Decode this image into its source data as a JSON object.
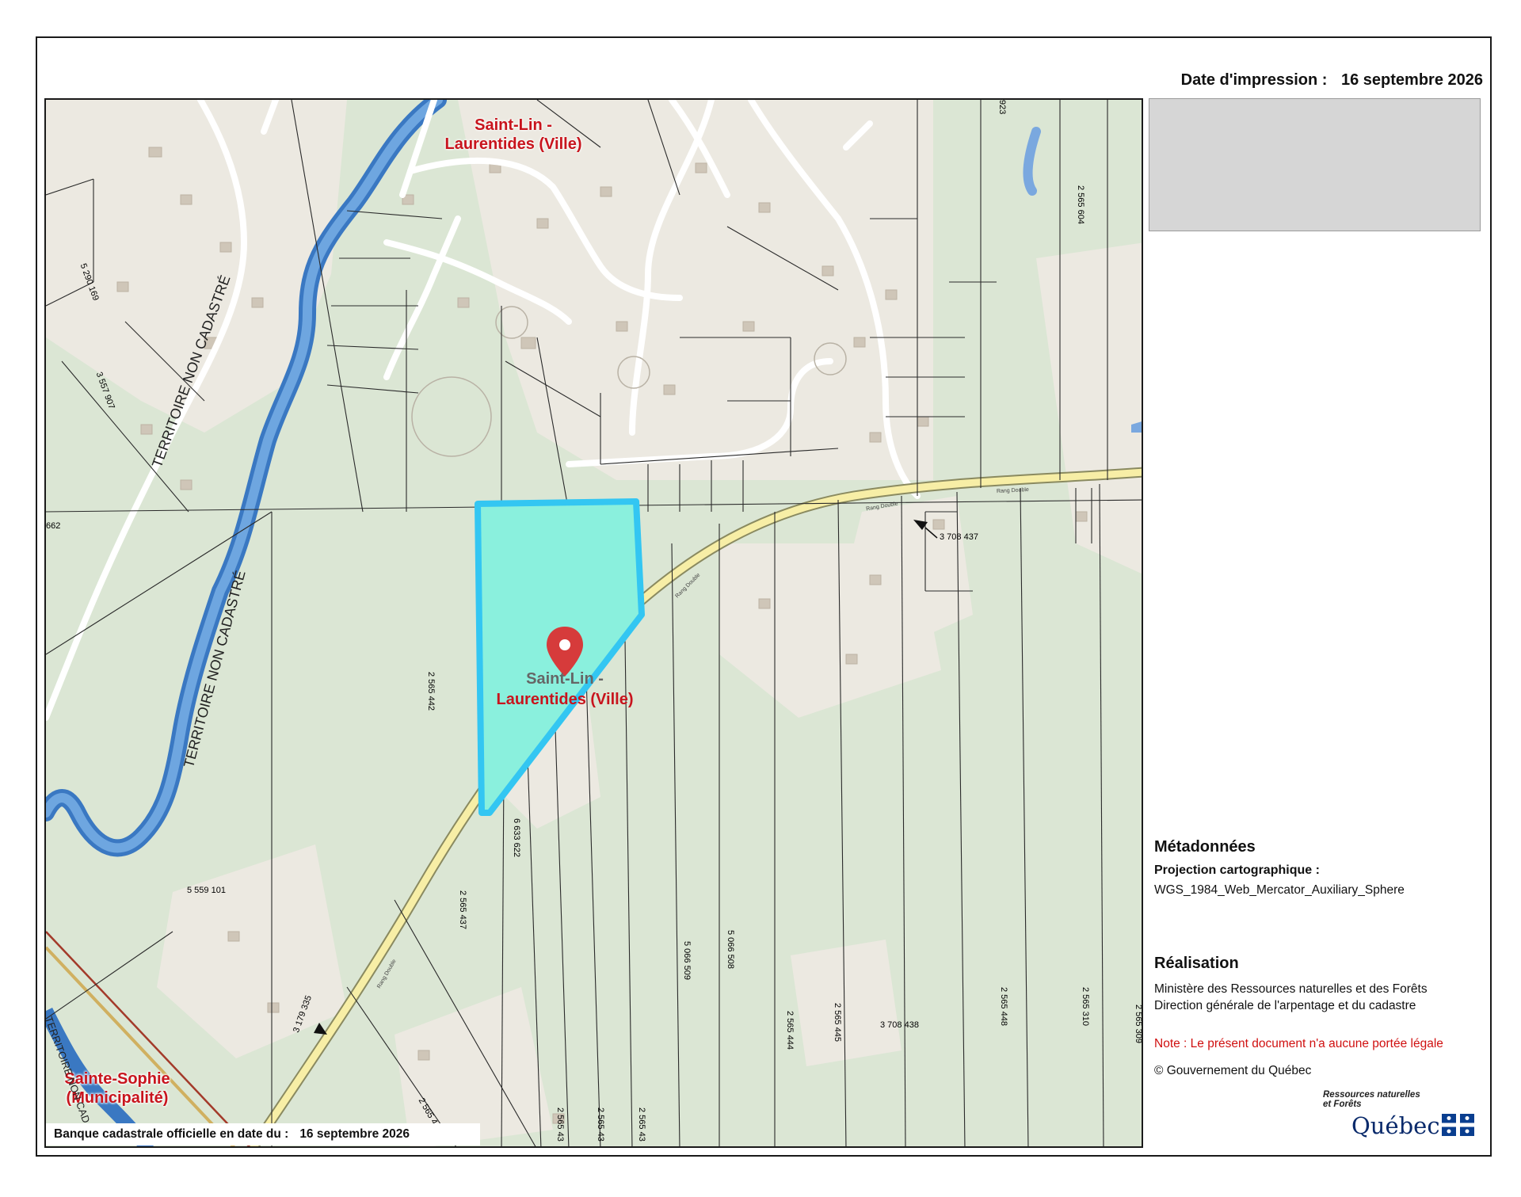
{
  "header": {
    "date_label": "Date d'impression :",
    "date_value": "16 septembre 2026"
  },
  "map": {
    "municipality_top": [
      "Saint-Lin -",
      "Laurentides (Ville)"
    ],
    "municipality_center": [
      "Saint-Lin -",
      "Laurentides (Ville)"
    ],
    "municipality_bottom": [
      "Sainte-Sophie",
      "(Municipalité)"
    ],
    "territory_label": "TERRITOIRE NON CADASTRÉ",
    "territory_label_2": "TERRITOIRE NON CADASTRÉ",
    "territory_label_3": "TERRITOIRE NON CADAS",
    "lot_numbers": {
      "lot_5290169": "5 290 169",
      "lot_3557907": "3 557 907",
      "lot_662": "662",
      "lot_2565442": "2 565 442",
      "lot_6633622": "6 633 622",
      "lot_5559101": "5 559 101",
      "lot_2565437": "2 565 437",
      "lot_3179335": "3 179 335",
      "lot_5066509": "5 066 509",
      "lot_5066508": "5 066 508",
      "lot_2565444": "2 565 444",
      "lot_2565445": "2 565 445",
      "lot_3708438": "3 708 438",
      "lot_3708437": "3 708 437",
      "lot_2565448": "2 565 448",
      "lot_2565310": "2 565 310",
      "lot_2565604": "2 565 604",
      "lot_923": "923",
      "lot_2565_43a": "2 565 43",
      "lot_2565_43b": "2 565 43",
      "lot_2565_43c": "2 565 43",
      "lot_2565_4": "2 565 4",
      "lot_2565_309": "2 565 309"
    },
    "road_name": "Rang Double",
    "selected_lot_color": "#8af0dd",
    "selected_lot_stroke": "#33c6f2",
    "marker_color": "#d63b3b"
  },
  "cadastre": {
    "label": "Banque cadastrale officielle en date du :",
    "value": "16 septembre 2026"
  },
  "metadata": {
    "title": "Métadonnées",
    "projection_label": "Projection cartographique :",
    "projection_value": "WGS_1984_Web_Mercator_Auxiliary_Sphere"
  },
  "realisation": {
    "title": "Réalisation",
    "line1": "Ministère des Ressources naturelles et des Forêts",
    "line2": "Direction générale de l'arpentage et du cadastre",
    "note": "Note : Le présent document n'a aucune portée légale",
    "copyright": "© Gouvernement du Québec"
  },
  "logo": {
    "tagline1": "Ressources naturelles",
    "tagline2": "et Forêts",
    "name": "Québec"
  }
}
